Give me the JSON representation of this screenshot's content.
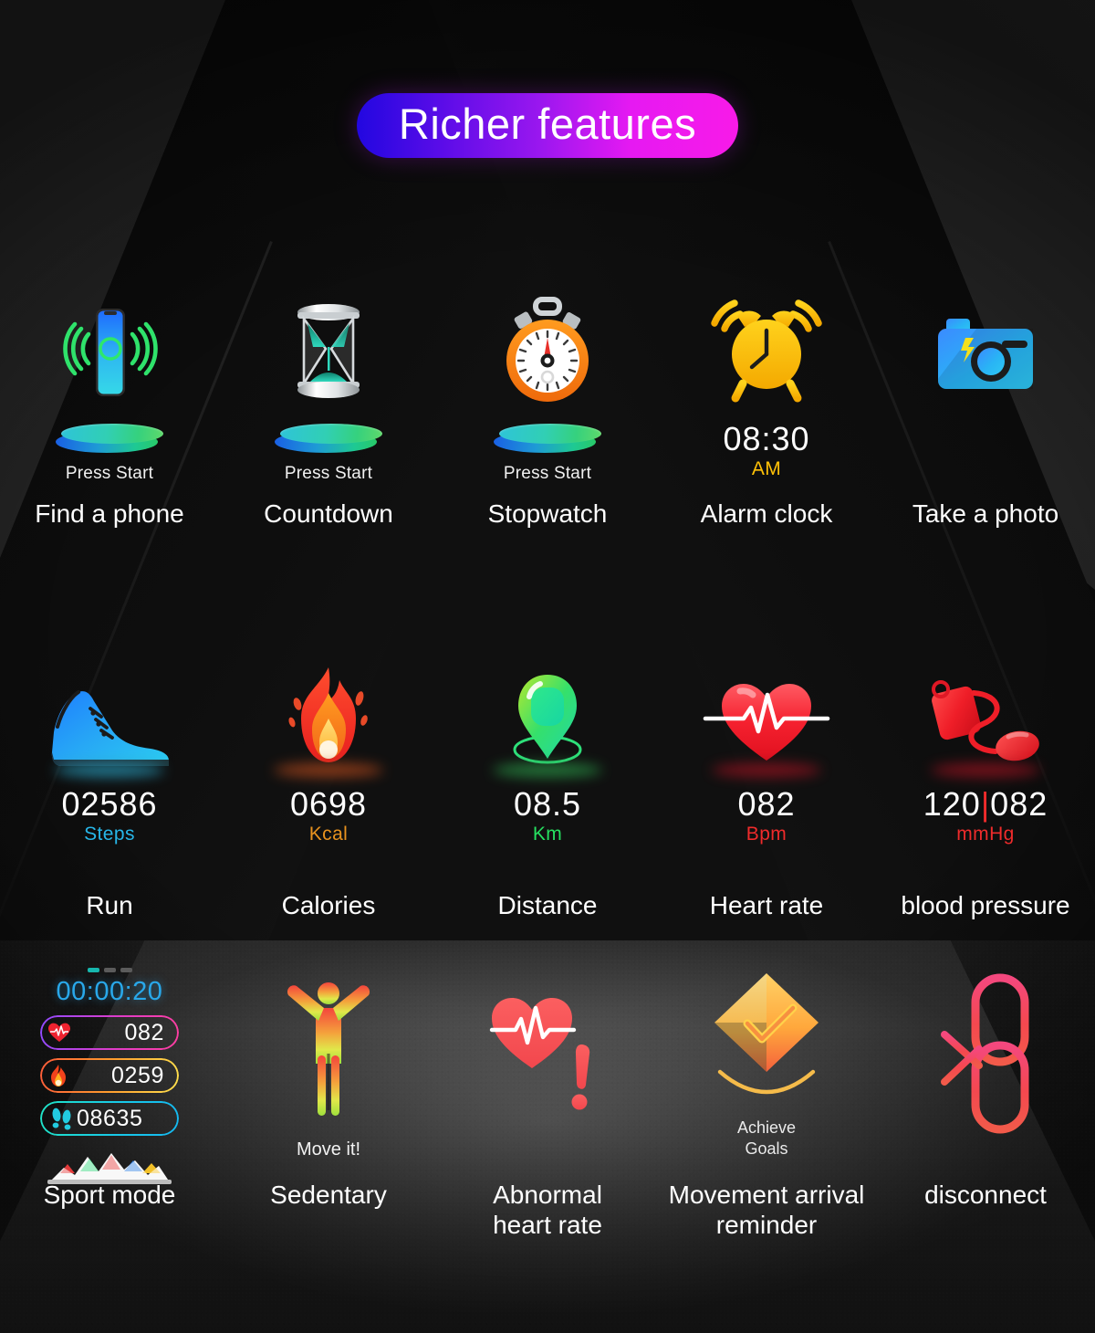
{
  "header": {
    "title": "Richer features",
    "gradient_from": "#2207e0",
    "gradient_to": "#f81ae8"
  },
  "rows": [
    {
      "id": "row-utilities",
      "items": [
        {
          "icon": "phone-signal-icon",
          "hint": "Press Start",
          "caption": "Find a phone",
          "accent": "#2bc5e0"
        },
        {
          "icon": "hourglass-icon",
          "hint": "Press Start",
          "caption": "Countdown",
          "accent": "#2bc5e0"
        },
        {
          "icon": "stopwatch-icon",
          "hint": "Press Start",
          "caption": "Stopwatch",
          "accent": "#ff8a1f"
        },
        {
          "icon": "alarm-clock-icon",
          "value": "08:30",
          "unit": "AM",
          "unit_color": "#ffc107",
          "caption": "Alarm clock",
          "accent": "#ffc107"
        },
        {
          "icon": "camera-icon",
          "caption": "Take a photo",
          "accent": "#28a8f5"
        }
      ]
    },
    {
      "id": "row-fitness",
      "items": [
        {
          "icon": "running-shoe-icon",
          "value": "02586",
          "unit": "Steps",
          "unit_color": "#27b6e8",
          "caption": "Run",
          "accent": "#27b6e8"
        },
        {
          "icon": "flame-icon",
          "value": "0698",
          "unit": "Kcal",
          "unit_color": "#e8921f",
          "caption": "Calories",
          "accent": "#e8561f"
        },
        {
          "icon": "location-pin-icon",
          "value": "08.5",
          "unit": "Km",
          "unit_color": "#26e060",
          "caption": "Distance",
          "accent": "#26e060"
        },
        {
          "icon": "heart-pulse-icon",
          "value": "082",
          "unit": "Bpm",
          "unit_color": "#ef2b2b",
          "caption": "Heart rate",
          "accent": "#ef2b2b"
        },
        {
          "icon": "blood-pressure-icon",
          "value": "120|082",
          "unit": "mmHg",
          "unit_color": "#ef2b2b",
          "caption": "blood pressure",
          "accent": "#ef2b2b"
        }
      ]
    },
    {
      "id": "row-alerts",
      "items": [
        {
          "icon": "sport-watch-screen-icon",
          "caption": "Sport mode"
        },
        {
          "icon": "standing-person-icon",
          "hint": "Move it!",
          "caption": "Sedentary"
        },
        {
          "icon": "abnormal-heart-icon",
          "caption": "Abnormal\nheart rate"
        },
        {
          "icon": "goal-badge-icon",
          "hint": "Achieve\nGoals",
          "caption": "Movement arrival\nreminder"
        },
        {
          "icon": "broken-link-icon",
          "caption": "disconnect"
        }
      ]
    }
  ],
  "sport_mode": {
    "page_dots": 3,
    "active_dot": 1,
    "timer": "00:00:20",
    "timer_color": "#29a8ea",
    "stats": [
      {
        "icon": "heart-icon",
        "value": "082",
        "ring_color": "#e03cc8"
      },
      {
        "icon": "flame-icon",
        "value": "0259",
        "ring_color": "#ff9b2d"
      },
      {
        "icon": "footsteps-icon",
        "value": "08635",
        "ring_color": "#18c9e8"
      }
    ]
  }
}
